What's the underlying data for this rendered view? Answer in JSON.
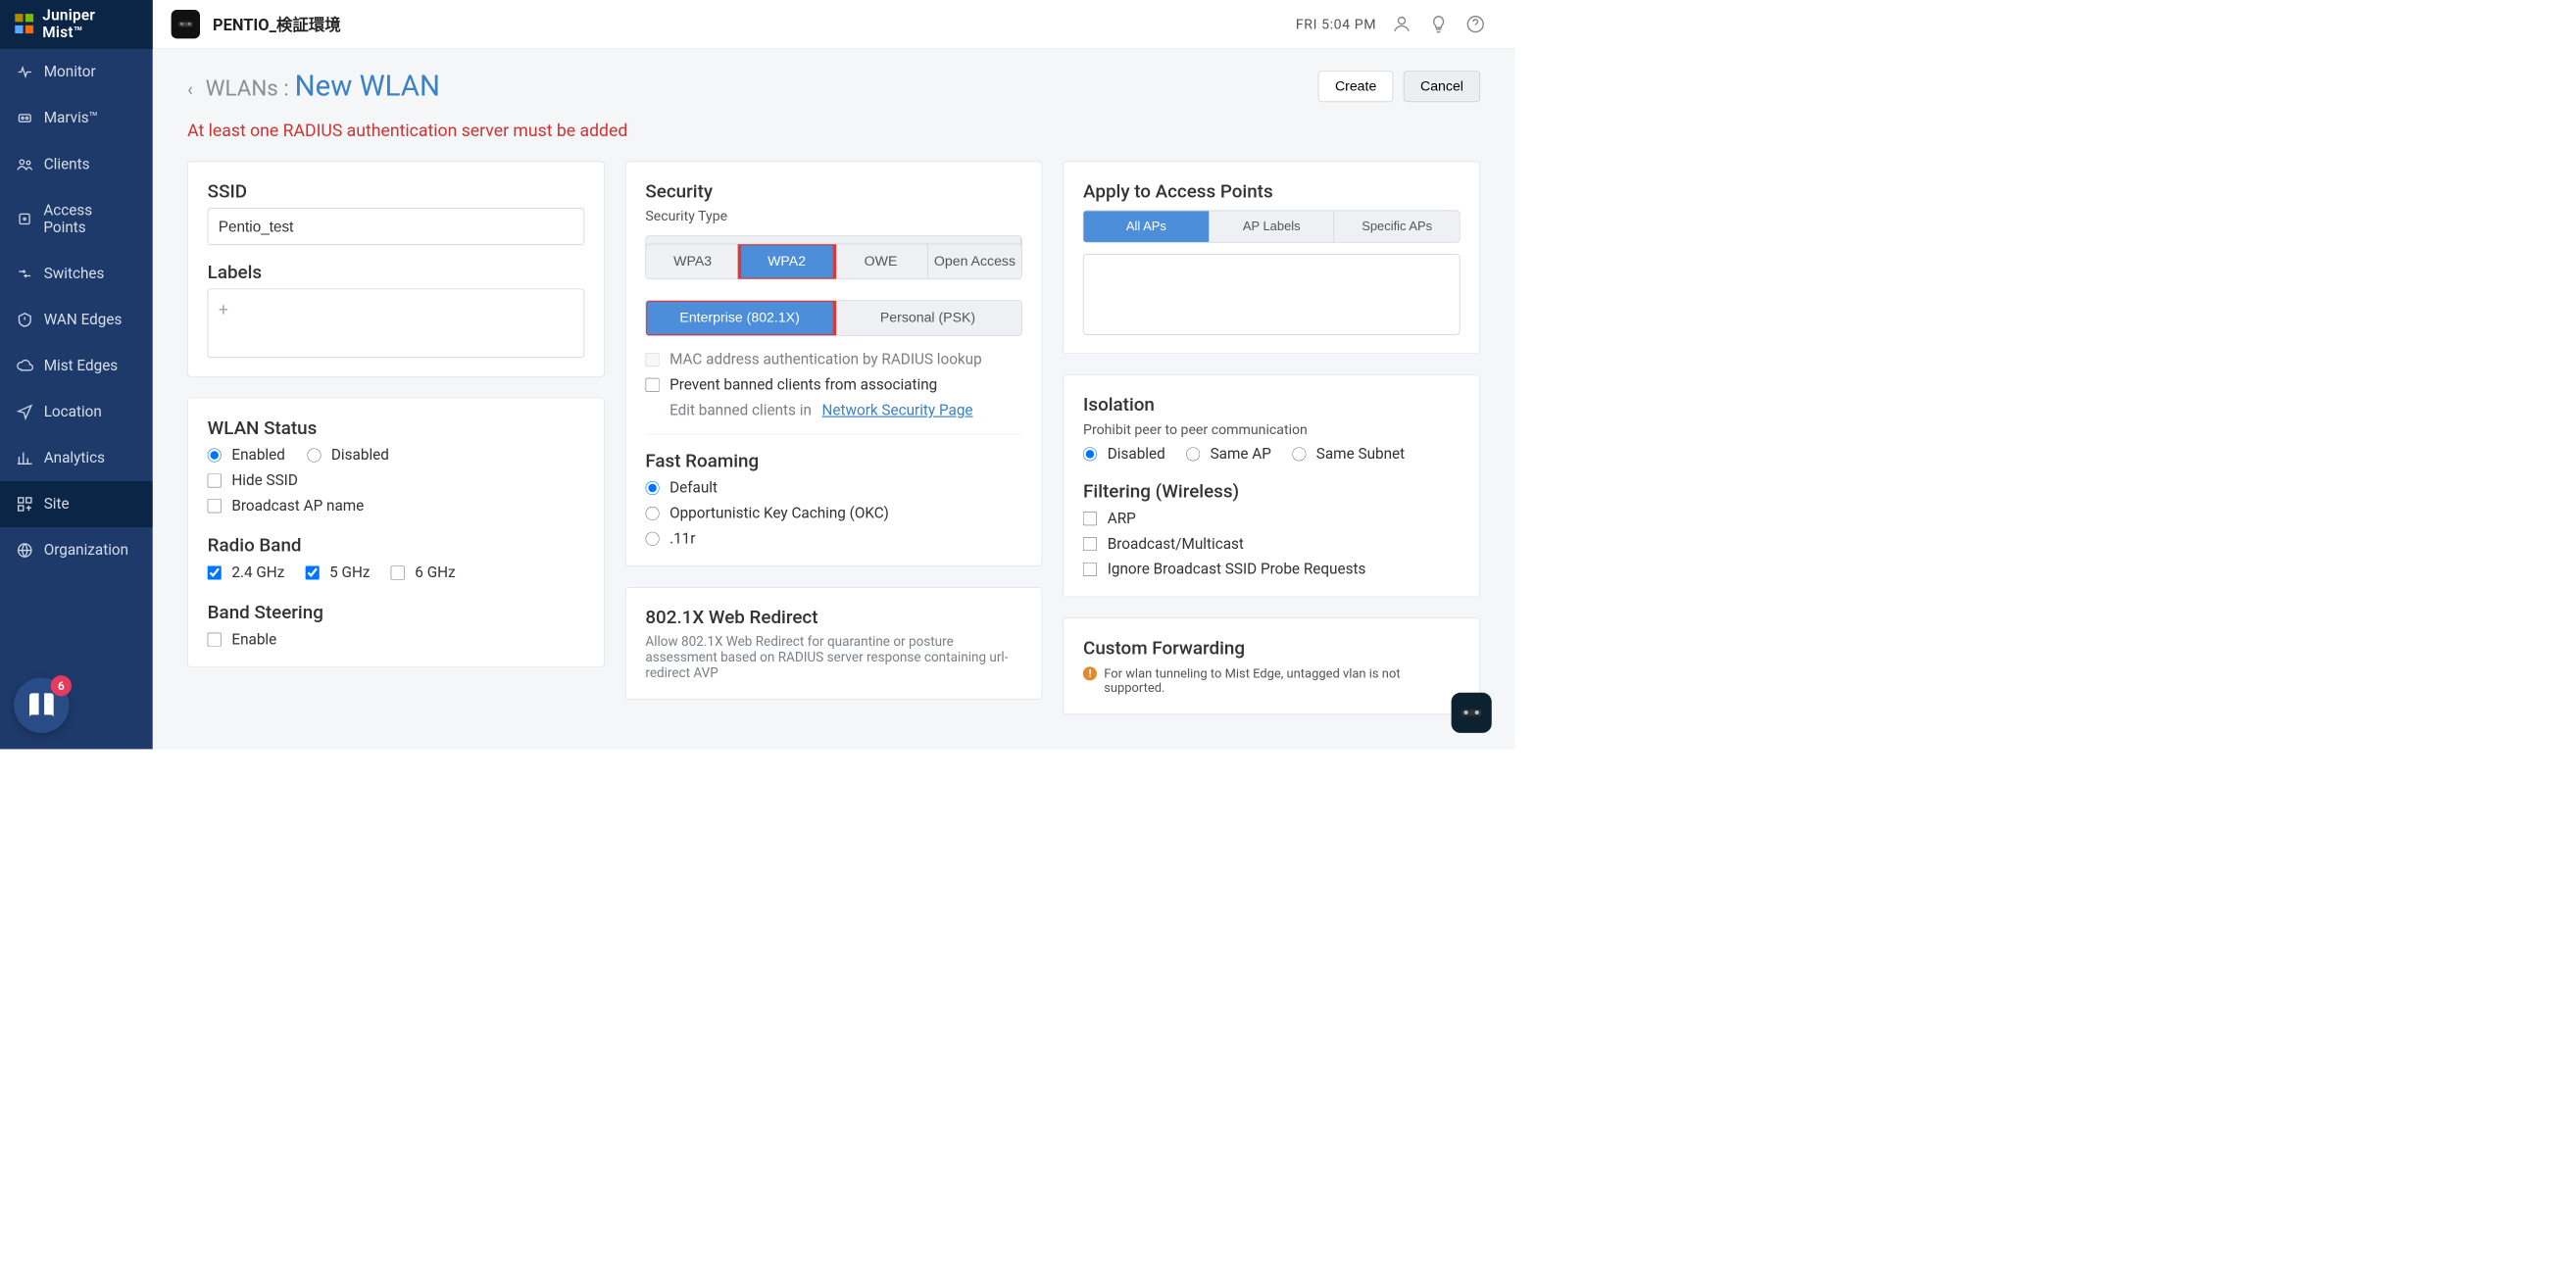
{
  "brand": {
    "name": "Juniper Mist™"
  },
  "org": {
    "name": "PENTIO_検証環境"
  },
  "topbar": {
    "time": "FRI 5:04 PM",
    "icons": {
      "user": "user-icon",
      "bulb": "bulb-icon",
      "help": "help-icon"
    }
  },
  "sidebar": {
    "items": [
      {
        "label": "Monitor"
      },
      {
        "label": "Marvis™"
      },
      {
        "label": "Clients"
      },
      {
        "label": "Access Points"
      },
      {
        "label": "Switches"
      },
      {
        "label": "WAN Edges"
      },
      {
        "label": "Mist Edges"
      },
      {
        "label": "Location"
      },
      {
        "label": "Analytics"
      },
      {
        "label": "Site"
      },
      {
        "label": "Organization"
      }
    ],
    "help_count": "6"
  },
  "header": {
    "breadcrumb": "WLANs :",
    "title": "New WLAN",
    "create": "Create",
    "cancel": "Cancel"
  },
  "error": "At least one RADIUS authentication server must be added",
  "ssid": {
    "heading": "SSID",
    "value": "Pentio_test",
    "labels_heading": "Labels",
    "add": "+"
  },
  "wlan_status": {
    "heading": "WLAN Status",
    "enabled": "Enabled",
    "disabled": "Disabled",
    "hide": "Hide SSID",
    "broadcast": "Broadcast AP name"
  },
  "radio": {
    "heading": "Radio Band",
    "b24": "2.4 GHz",
    "b5": "5 GHz",
    "b6": "6 GHz"
  },
  "band_steering": {
    "heading": "Band Steering",
    "enable": "Enable"
  },
  "security": {
    "heading": "Security",
    "type_label": "Security Type",
    "types": [
      "WPA3",
      "WPA2",
      "OWE",
      "Open Access"
    ],
    "auth_modes": [
      "Enterprise (802.1X)",
      "Personal (PSK)"
    ],
    "mac_auth": "MAC address authentication by RADIUS lookup",
    "prevent_banned": "Prevent banned clients from associating",
    "edit_banned_prefix": "Edit banned clients in ",
    "edit_banned_link": "Network Security Page"
  },
  "fast_roaming": {
    "heading": "Fast Roaming",
    "default": "Default",
    "okc": "Opportunistic Key Caching (OKC)",
    "r11": ".11r"
  },
  "web_redirect": {
    "heading": "802.1X Web Redirect",
    "desc": "Allow 802.1X Web Redirect for quarantine or posture assessment based on RADIUS server response containing url-redirect AVP"
  },
  "apply_aps": {
    "heading": "Apply to Access Points",
    "tabs": [
      "All APs",
      "AP Labels",
      "Specific APs"
    ]
  },
  "isolation": {
    "heading": "Isolation",
    "desc": "Prohibit peer to peer communication",
    "disabled": "Disabled",
    "same_ap": "Same AP",
    "same_subnet": "Same Subnet"
  },
  "filtering": {
    "heading": "Filtering (Wireless)",
    "arp": "ARP",
    "bcast": "Broadcast/Multicast",
    "ignore": "Ignore Broadcast SSID Probe Requests"
  },
  "custom_fwd": {
    "heading": "Custom Forwarding",
    "note": "For wlan tunneling to Mist Edge, untagged vlan is not supported."
  }
}
